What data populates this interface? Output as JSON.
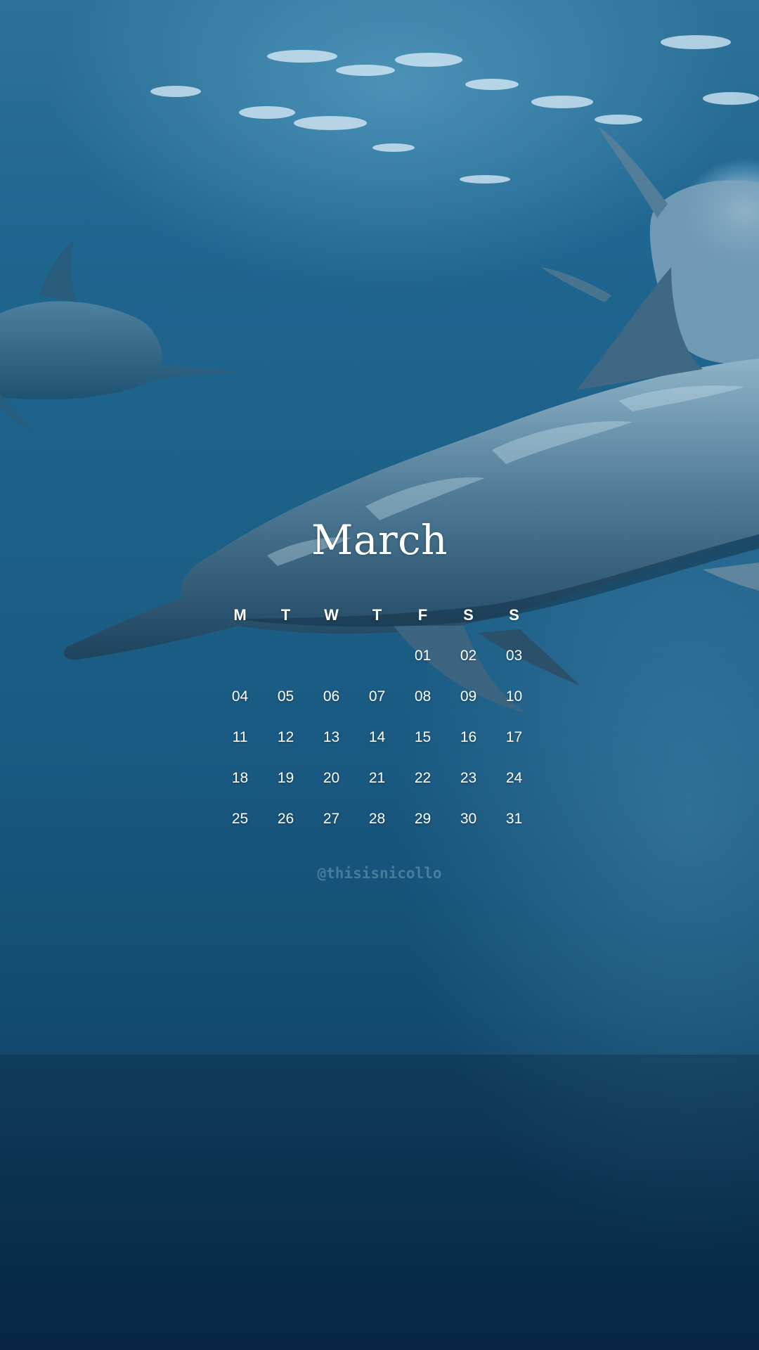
{
  "calendar": {
    "month": "March",
    "weekdays": [
      "M",
      "T",
      "W",
      "T",
      "F",
      "S",
      "S"
    ],
    "weeks": [
      [
        "",
        "",
        "",
        "",
        "01",
        "02",
        "03"
      ],
      [
        "04",
        "05",
        "06",
        "07",
        "08",
        "09",
        "10"
      ],
      [
        "11",
        "12",
        "13",
        "14",
        "15",
        "16",
        "17"
      ],
      [
        "18",
        "19",
        "20",
        "21",
        "22",
        "23",
        "24"
      ],
      [
        "25",
        "26",
        "27",
        "28",
        "29",
        "30",
        "31"
      ]
    ]
  },
  "credit": "@thisisnicollo",
  "colors": {
    "water_top": "#2c7299",
    "water_bottom": "#08294a",
    "text": "#ffffff"
  }
}
